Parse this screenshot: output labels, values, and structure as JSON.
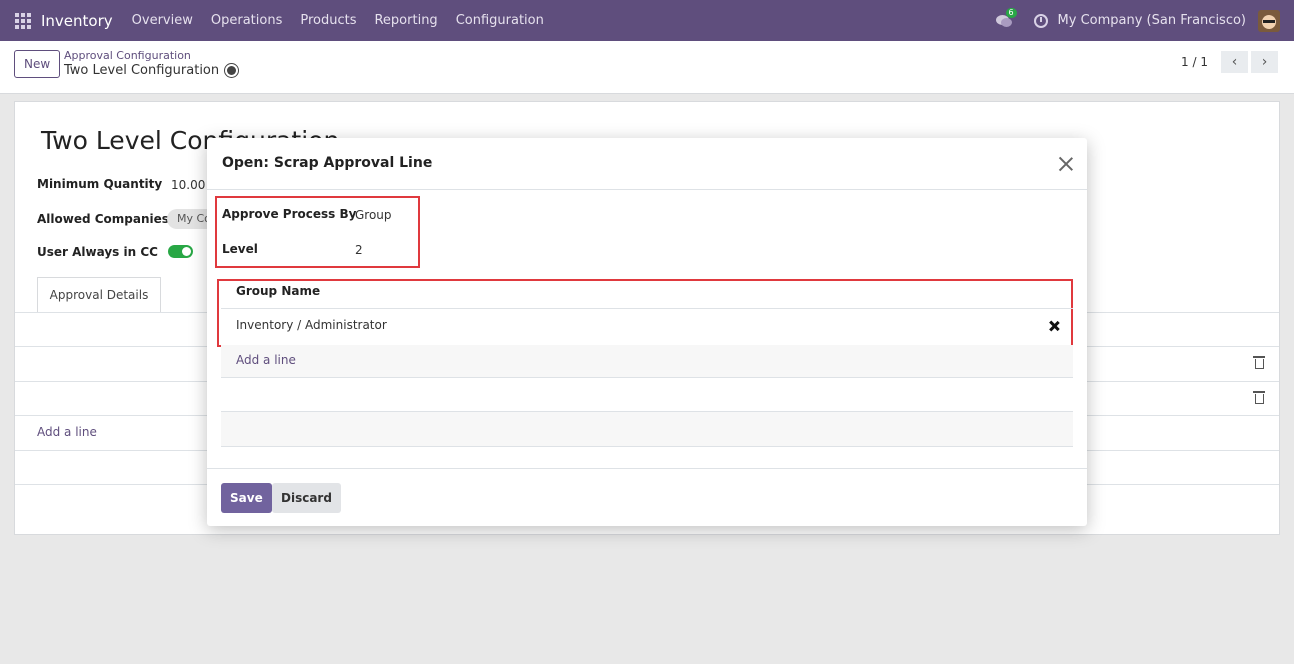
{
  "navbar": {
    "app_name": "Inventory",
    "menu": [
      "Overview",
      "Operations",
      "Products",
      "Reporting",
      "Configuration"
    ],
    "chat_badge": "6",
    "company": "My Company (San Francisco)"
  },
  "control": {
    "new_label": "New",
    "breadcrumb_parent": "Approval Configuration",
    "breadcrumb_current": "Two Level Configuration",
    "pager_value": "1 / 1"
  },
  "form": {
    "title": "Two Level Configuration",
    "min_qty_label": "Minimum Quantity",
    "min_qty_value": "10.00",
    "allowed_companies_label": "Allowed Companies",
    "company_tag": "My Company (San Francisco)",
    "user_cc_label": "User Always in CC",
    "user_cc_enabled": true,
    "tab_label": "Approval Details",
    "add_line": "Add a line"
  },
  "modal": {
    "title": "Open: Scrap Approval Line",
    "approve_by_label": "Approve Process By",
    "approve_by_value": "Group",
    "level_label": "Level",
    "level_value": "2",
    "table_header": "Group Name",
    "rows": [
      "Inventory / Administrator"
    ],
    "add_line": "Add a line",
    "save_label": "Save",
    "discard_label": "Discard"
  },
  "colors": {
    "navbar": "#5f4e7d",
    "primary": "#71639e",
    "highlight": "#e0393e",
    "toggle_on": "#28a745"
  }
}
